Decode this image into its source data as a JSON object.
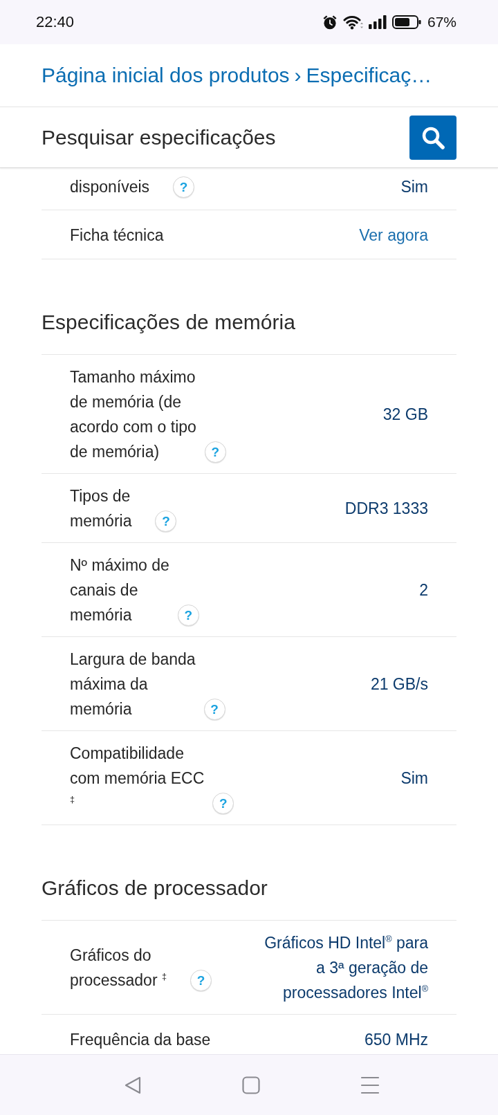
{
  "status_bar": {
    "time": "22:40",
    "battery": "67%"
  },
  "breadcrumb": {
    "items": [
      "Página inicial dos produtos",
      "Especificaç…"
    ],
    "separator": "›"
  },
  "search": {
    "placeholder": "Pesquisar especificações"
  },
  "sections": [
    {
      "rows": [
        {
          "kind": "text",
          "label": "disponíveis",
          "help": "?",
          "value": "Sim"
        },
        {
          "kind": "link",
          "label": "Ficha técnica",
          "value": "Ver agora"
        }
      ]
    },
    {
      "heading": "Especificações de memória",
      "rows": [
        {
          "kind": "text",
          "label": "Tamanho máximo de memória (de acordo com o tipo de memória)",
          "help": "?",
          "value": "32 GB"
        },
        {
          "kind": "text",
          "label": "Tipos de memória",
          "help": "?",
          "value": "DDR3 1333"
        },
        {
          "kind": "text",
          "label": "Nº máximo de canais de memória",
          "help": "?",
          "value": "2"
        },
        {
          "kind": "text",
          "label": "Largura de banda máxima da memória",
          "help": "?",
          "value": "21 GB/s"
        },
        {
          "kind": "text",
          "label": "Compatibilidade com memória ECC $^{‡}$",
          "help": "?",
          "value": "Sim"
        }
      ]
    },
    {
      "heading": "Gráficos de processador",
      "rows": [
        {
          "kind": "text",
          "label": "Gráficos do processador $^{‡}$",
          "help": "?",
          "value": "Gráficos HD Intel$^{®}$ para a 3ª geração de processadores Intel$^{®}$"
        },
        {
          "kind": "text",
          "label": "Frequência da base",
          "value": "650 MHz"
        }
      ]
    }
  ]
}
